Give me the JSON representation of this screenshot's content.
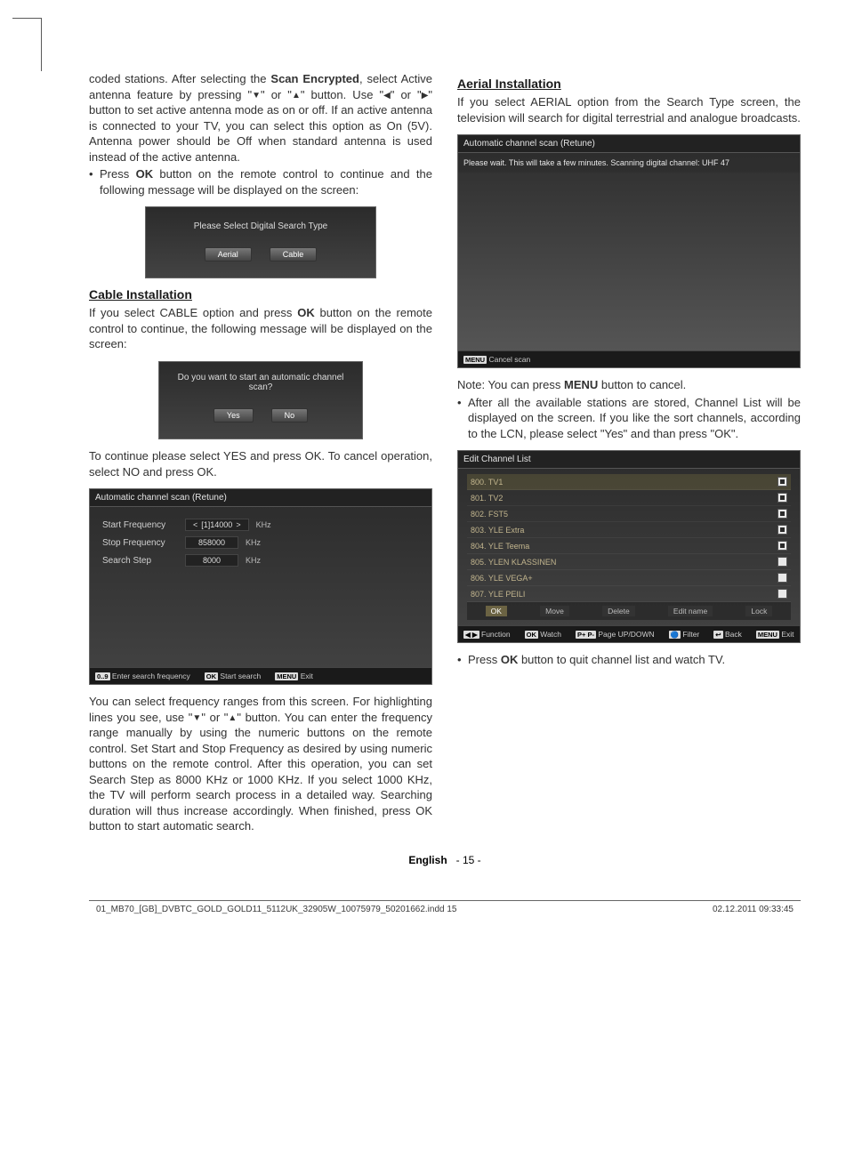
{
  "text": {
    "p1a": "coded stations. After selecting the ",
    "bold_scan": "Scan Encrypted",
    "p1b": ", select Active antenna feature by pressing \"",
    "p1c": "\" or \"",
    "p1d": "\" button. Use \"",
    "p1e": "\" or \"",
    "p1f": "\" button to set active antenna mode as on or off. If an active antenna is connected to your TV, you can select this option as On (5V). Antenna power should be Off when standard antenna is used instead of the active antenna.",
    "p2a": "Press ",
    "bold_ok": "OK",
    "p2b": " button on the remote control to continue and the following message will be displayed on the screen:",
    "cable_h": "Cable Installation",
    "cable_p_a": "If you select CABLE option and press ",
    "cable_p_b": " button on the remote control to continue, the following message will be displayed on the screen:",
    "cont": "To continue please select YES and press OK. To cancel operation, select NO and press OK.",
    "freq": "You can select frequency ranges from this screen. For highlighting lines you see, use \"",
    "freq2": "\" or \"",
    "freq3": "\" button. You can enter the frequency range manually by using the numeric buttons on the remote control. Set Start and Stop Frequency as desired by using numeric buttons on the remote control. After this operation, you can set Search Step as 8000 KHz or 1000 KHz. If you select 1000 KHz, the TV will perform search process in a detailed way. Searching duration will thus increase accordingly. When finished, press OK button to start automatic search.",
    "aerial_h": "Aerial Installation",
    "aerial_p": "If you select AERIAL option from the Search Type screen, the television will search for digital terrestrial and analogue broadcasts.",
    "note_a": "Note: You can press ",
    "bold_menu": "MENU",
    "note_b": " button to cancel.",
    "after_a": "After all the available stations are stored, Channel List will be displayed on the screen. If you like the sort channels, according to the LCN, please select \"Yes\" and than press \"OK\".",
    "quit_a": "Press ",
    "quit_b": " button to quit channel list and watch TV.",
    "footer_lang": "English",
    "footer_page": "- 15 -"
  },
  "ui_search_type": {
    "title": "Please Select Digital Search Type",
    "btn1": "Aerial",
    "btn2": "Cable"
  },
  "ui_auto_scan_q": {
    "q": "Do you want to start an automatic channel scan?",
    "yes": "Yes",
    "no": "No"
  },
  "ui_retune_form": {
    "title": "Automatic channel scan (Retune)",
    "rows": [
      {
        "label": "Start Frequency",
        "value": "[1]14000",
        "unit": "KHz",
        "arrows": true
      },
      {
        "label": "Stop Frequency",
        "value": "858000",
        "unit": "KHz",
        "arrows": false
      },
      {
        "label": "Search Step",
        "value": "8000",
        "unit": "KHz",
        "arrows": false
      }
    ],
    "hints": {
      "h1": "Enter search frequency",
      "h2": "Start search",
      "h3": "Exit",
      "k1": "0..9",
      "k2": "OK",
      "k3": "MENU"
    }
  },
  "ui_scan_progress": {
    "title": "Automatic channel scan (Retune)",
    "wait": "Please wait. This will take a few minutes. Scanning digital channel: UHF 47",
    "hint_label": "Cancel scan",
    "hint_key": "MENU"
  },
  "ui_channel_list": {
    "title": "Edit Channel List",
    "items": [
      "800. TV1",
      "801. TV2",
      "802. FST5",
      "803. YLE Extra",
      "804. YLE Teema",
      "805. YLEN KLASSINEN",
      "806. YLE VEGA+",
      "807. YLE PEILI"
    ],
    "actions": [
      "OK",
      "Move",
      "Delete",
      "Edit name",
      "Lock"
    ],
    "hints": {
      "func": "Function",
      "k_ok": "OK",
      "watch": "Watch",
      "k_pp": "P+ P-",
      "page": "Page UP/DOWN",
      "filt": "Filter",
      "back": "Back",
      "exit": "Exit",
      "k_menu": "MENU",
      "k_back": "↩"
    }
  },
  "footer_line": {
    "left": "01_MB70_[GB]_DVBTC_GOLD_GOLD11_5112UK_32905W_10075979_50201662.indd   15",
    "right": "02.12.2011   09:33:45"
  }
}
